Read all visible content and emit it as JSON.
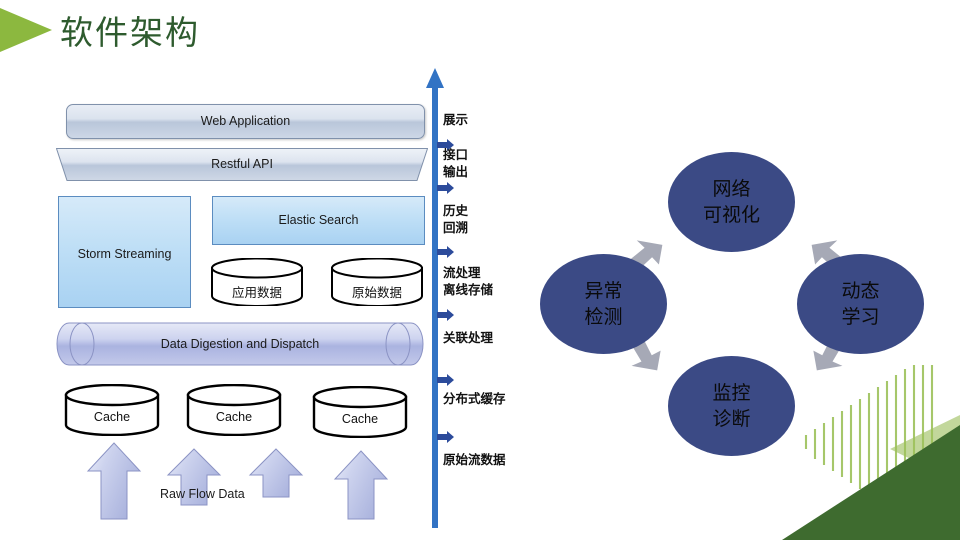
{
  "slide": {
    "title": "软件架构",
    "title_color": "#2e5b2e",
    "accent_green": "#8cb83f",
    "background": "#ffffff"
  },
  "architecture": {
    "name": "software-architecture-stack",
    "layers": [
      {
        "id": "web-application",
        "label": "Web Application",
        "shape": "rounded-rect",
        "fill": "#cdd7e6"
      },
      {
        "id": "restful-api",
        "label": "Restful API",
        "shape": "trapezoid",
        "fill": "#cdd7e6"
      },
      {
        "id": "storm-streaming",
        "label": "Storm Streaming",
        "shape": "rect",
        "fill": "#bfdff6"
      },
      {
        "id": "elastic-search",
        "label": "Elastic Search",
        "shape": "rect",
        "fill": "#bfdff6"
      },
      {
        "id": "data-digestion",
        "label": "Data Digestion and Dispatch",
        "shape": "horizontal-cylinder",
        "fill": "#b6bee4"
      }
    ],
    "databases": [
      {
        "id": "app-data",
        "label": "应用数据"
      },
      {
        "id": "raw-data",
        "label": "原始数据"
      }
    ],
    "caches": [
      {
        "id": "cache-1",
        "label": "Cache"
      },
      {
        "id": "cache-2",
        "label": "Cache"
      },
      {
        "id": "cache-3",
        "label": "Cache"
      }
    ],
    "input_label": "Raw Flow Data",
    "input_arrow_count": 4
  },
  "axis": {
    "name": "processing-stage-axis",
    "direction": "upward",
    "color": "#3273c4",
    "stages": [
      {
        "id": "stage-presentation",
        "label": "展示"
      },
      {
        "id": "stage-api-output",
        "label": "接口\n输出",
        "lines": [
          "接口",
          "输出"
        ]
      },
      {
        "id": "stage-history",
        "label": "历史\n回溯",
        "lines": [
          "历史",
          "回溯"
        ]
      },
      {
        "id": "stage-stream-storage",
        "label": "流处理\n离线存储",
        "lines": [
          "流处理",
          "离线存储"
        ]
      },
      {
        "id": "stage-correlation",
        "label": "关联处理",
        "lines": [
          "关联处理"
        ]
      },
      {
        "id": "stage-dist-cache",
        "label": "分布式缓存",
        "lines": [
          "分布式缓存"
        ]
      },
      {
        "id": "stage-raw-stream",
        "label": "原始流数据",
        "lines": [
          "原始流数据"
        ]
      }
    ]
  },
  "cycle": {
    "name": "capability-cycle",
    "fill": "#3b4a85",
    "arrow_fill": "#a6a9b6",
    "nodes": [
      {
        "id": "node-network-visualization",
        "position": "top",
        "lines": [
          "网络",
          "可视化"
        ]
      },
      {
        "id": "node-dynamic-learning",
        "position": "right",
        "lines": [
          "动态",
          "学习"
        ]
      },
      {
        "id": "node-monitor-diagnosis",
        "position": "bottom",
        "lines": [
          "监控",
          "诊断"
        ]
      },
      {
        "id": "node-anomaly-detection",
        "position": "left",
        "lines": [
          "异常",
          "检测"
        ]
      }
    ],
    "connectors": [
      {
        "id": "arrow-left-to-top",
        "from": "node-anomaly-detection",
        "to": "node-network-visualization"
      },
      {
        "id": "arrow-top-to-right",
        "from": "node-network-visualization",
        "to": "node-dynamic-learning"
      },
      {
        "id": "arrow-right-to-bottom",
        "from": "node-dynamic-learning",
        "to": "node-monitor-diagnosis"
      },
      {
        "id": "arrow-bottom-to-left",
        "from": "node-monitor-diagnosis",
        "to": "node-anomaly-detection"
      }
    ]
  },
  "decoration": {
    "corner_dark_green": "#3e6b2f",
    "corner_light_green": "#b7d08a",
    "stripe_green": "#9dc15a"
  }
}
